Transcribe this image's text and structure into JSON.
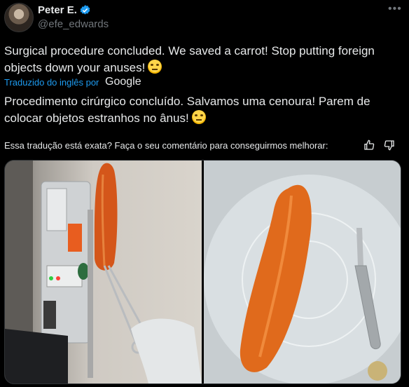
{
  "tweet": {
    "author_name": "Peter E.",
    "handle": "@efe_edwards",
    "more_label": "•••",
    "original_text": "Surgical procedure concluded. We saved a carrot! Stop putting foreign objects down your anuses!",
    "translated_note": "Traduzido do inglês por",
    "translator_brand": "Google",
    "translated_text": "Procedimento cirúrgico concluído. Salvamos uma cenoura! Parem de colocar objetos estranhos no ânus!",
    "feedback_prompt": "Essa tradução está exata? Faça o seu comentário para conseguirmos melhorar:"
  },
  "colors": {
    "background": "#000000",
    "text": "#e7e9ea",
    "muted": "#71767b",
    "link": "#1d9bf0",
    "verified": "#1d9bf0"
  },
  "icons": [
    "verified-badge-icon",
    "more-options-icon",
    "face-rolling-eyes-emoji",
    "thumbs-up-icon",
    "thumbs-down-icon"
  ]
}
